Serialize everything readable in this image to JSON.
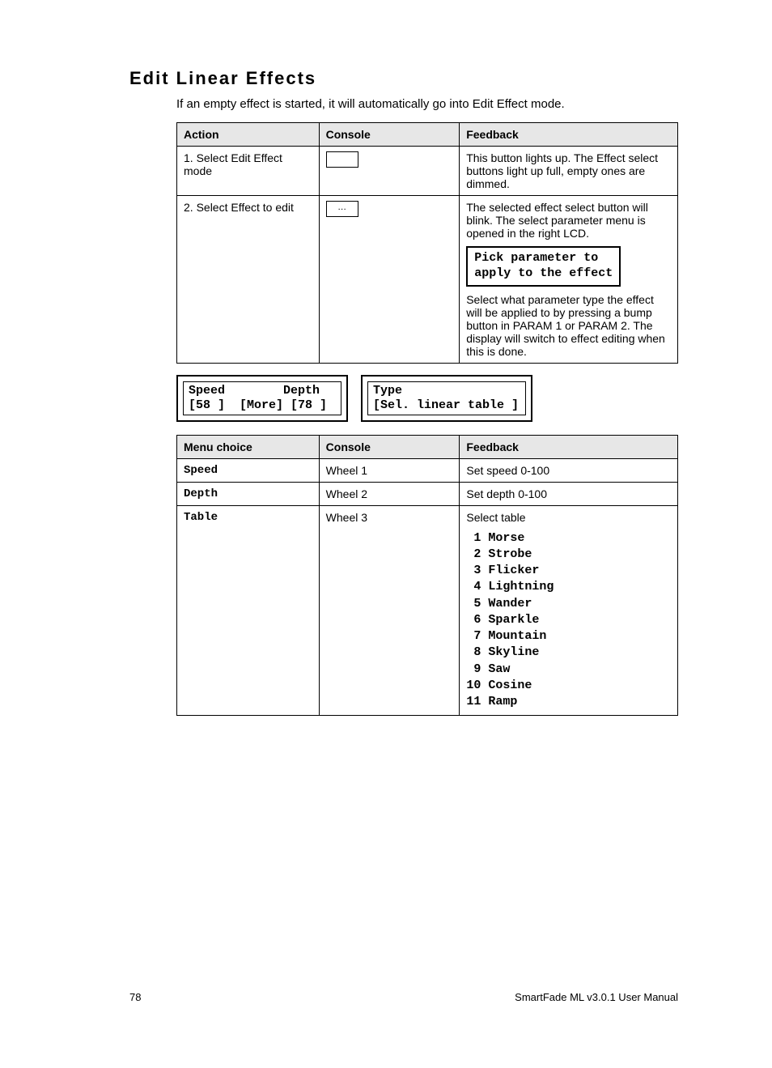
{
  "title": "Edit Linear Effects",
  "intro": "If an empty effect is started, it will automatically go into Edit Effect mode.",
  "table1": {
    "headers": {
      "action": "Action",
      "console": "Console",
      "feedback": "Feedback"
    },
    "rows": [
      {
        "action": "1. Select Edit Effect mode",
        "feedback": "This button lights up. The Effect select buttons light up full, empty ones are dimmed."
      },
      {
        "action": "2. Select Effect to edit",
        "feedback_before": "The selected effect select button will blink. The select parameter menu is opened in the right LCD.",
        "lcd": "Pick parameter to\napply to the effect",
        "feedback_after": "Select what parameter type the effect will be applied to by pressing a bump button in PARAM 1 or PARAM 2. The display will switch to effect editing when this is done."
      }
    ]
  },
  "lcd_left": "Speed        Depth\n[58 ]  [More] [78 ]",
  "lcd_right": "Type\n[Sel. linear table ]",
  "table2": {
    "headers": {
      "menu": "Menu choice",
      "console": "Console",
      "feedback": "Feedback"
    },
    "rows": [
      {
        "menu": "Speed",
        "console": "Wheel 1",
        "feedback": "Set speed 0-100"
      },
      {
        "menu": "Depth",
        "console": "Wheel 2",
        "feedback": "Set depth 0-100"
      },
      {
        "menu": "Table",
        "console": "Wheel 3",
        "feedback": "Select table",
        "list": " 1 Morse\n 2 Strobe\n 3 Flicker\n 4 Lightning\n 5 Wander\n 6 Sparkle\n 7 Mountain\n 8 Skyline\n 9 Saw\n10 Cosine\n11 Ramp"
      }
    ]
  },
  "footer": {
    "page": "78",
    "doc": "SmartFade ML v3.0.1 User Manual"
  }
}
